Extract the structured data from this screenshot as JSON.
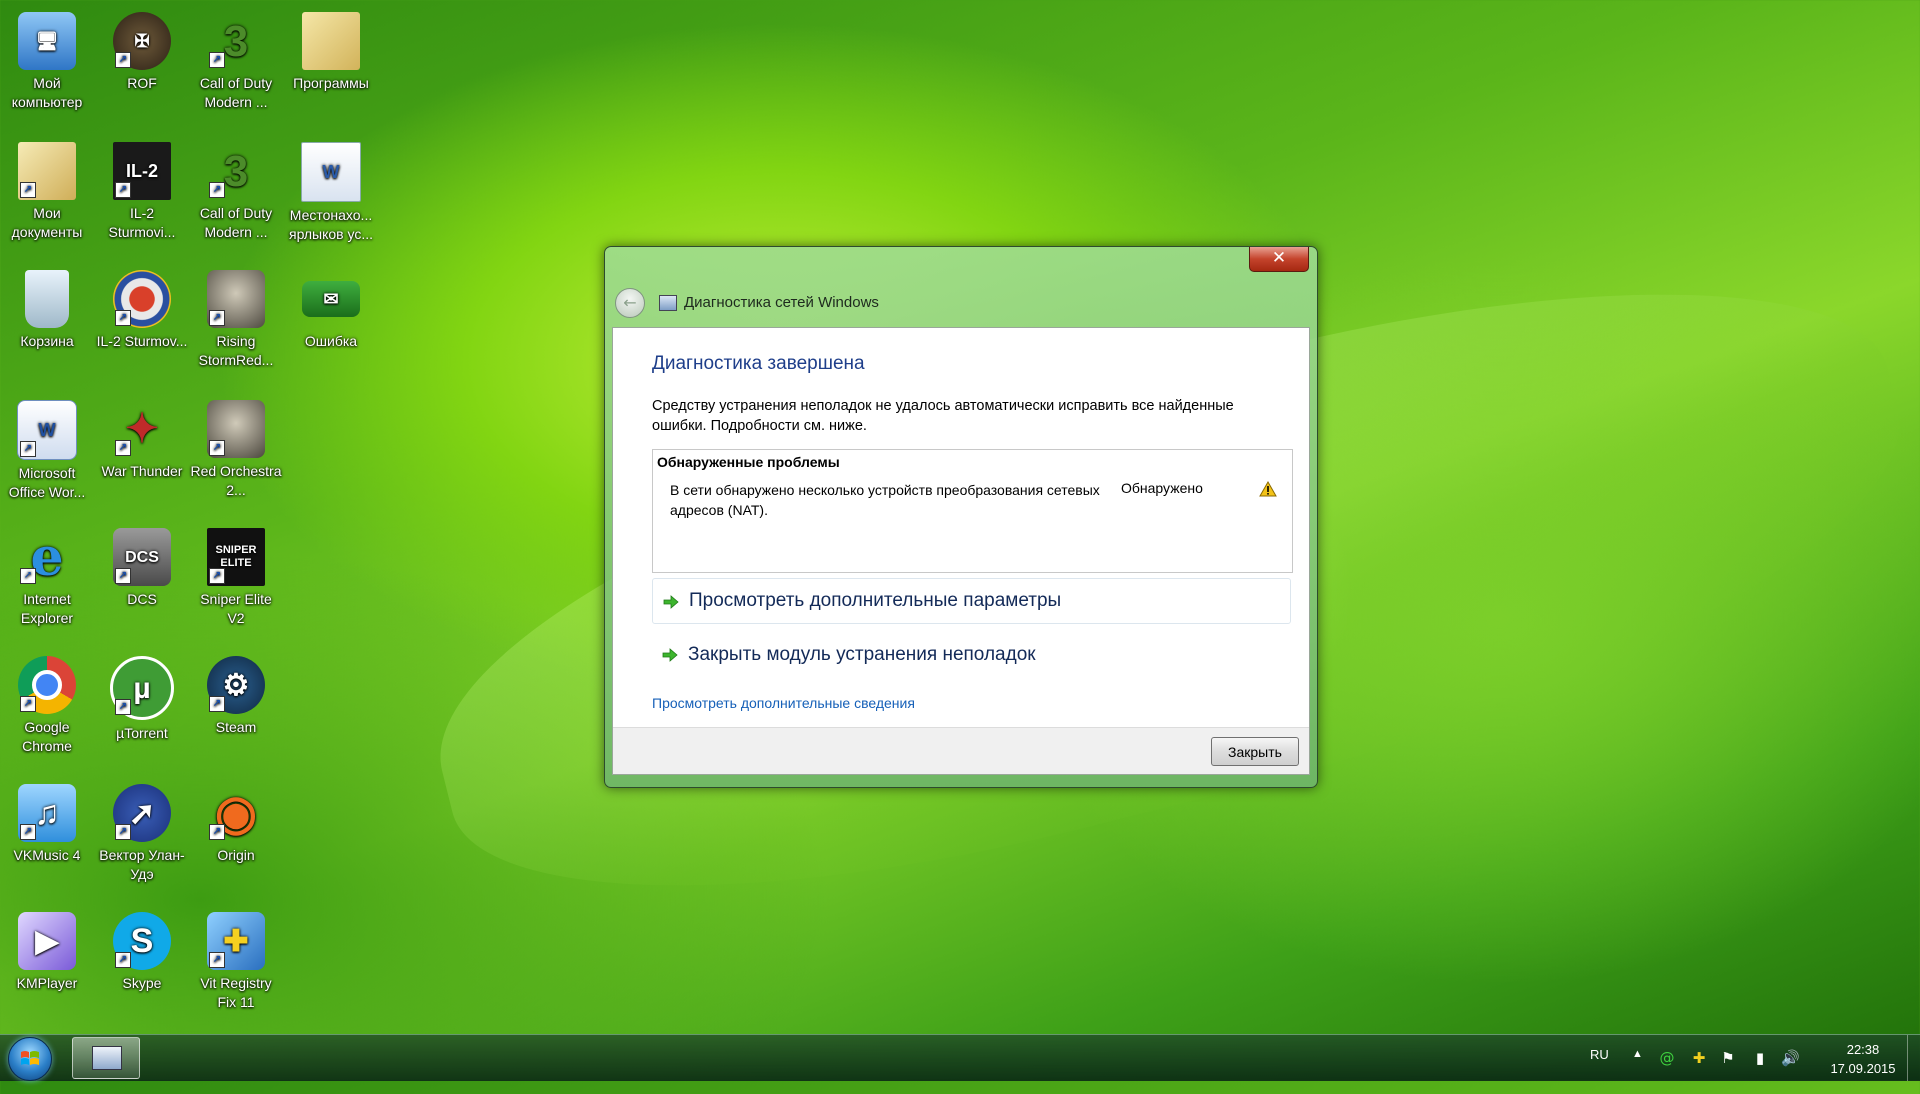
{
  "desktop": {
    "icons": [
      {
        "label": "Мой компьютер",
        "icon": "computer-icon"
      },
      {
        "label": "ROF",
        "icon": "rof-icon"
      },
      {
        "label": "Call of Duty Modern ...",
        "icon": "call-of-duty-icon"
      },
      {
        "label": "Программы",
        "icon": "folder-icon"
      },
      {
        "label": "Мои документы",
        "icon": "documents-folder-icon"
      },
      {
        "label": "IL-2 Sturmovi...",
        "icon": "il2-stalingrad-icon"
      },
      {
        "label": "Call of Duty Modern ...",
        "icon": "call-of-duty-icon"
      },
      {
        "label": "Местонахо... ярлыков ус...",
        "icon": "word-document-icon"
      },
      {
        "label": "Корзина",
        "icon": "recycle-bin-icon"
      },
      {
        "label": "IL-2 Sturmov...",
        "icon": "il2-target-icon"
      },
      {
        "label": "Rising StormRed...",
        "icon": "soldier-icon"
      },
      {
        "label": "Ошибка",
        "icon": "error-icon"
      },
      {
        "label": "Microsoft Office Wor...",
        "icon": "ms-word-icon"
      },
      {
        "label": "War Thunder",
        "icon": "war-thunder-icon"
      },
      {
        "label": "Red Orchestra 2...",
        "icon": "soldier-icon"
      },
      {
        "label": "Internet Explorer",
        "icon": "internet-explorer-icon"
      },
      {
        "label": "DCS",
        "icon": "dcs-icon"
      },
      {
        "label": "Sniper Elite V2",
        "icon": "sniper-elite-icon"
      },
      {
        "label": "Google Chrome",
        "icon": "chrome-icon"
      },
      {
        "label": "µTorrent",
        "icon": "utorrent-icon"
      },
      {
        "label": "Steam",
        "icon": "steam-icon"
      },
      {
        "label": "VKMusic 4",
        "icon": "vkmusic-icon"
      },
      {
        "label": "Вектор Улан-Удэ",
        "icon": "vector-icon"
      },
      {
        "label": "Origin",
        "icon": "origin-icon"
      },
      {
        "label": "KMPlayer",
        "icon": "kmplayer-icon"
      },
      {
        "label": "Skype",
        "icon": "skype-icon"
      },
      {
        "label": "Vit Registry Fix 11",
        "icon": "registry-fix-icon"
      }
    ],
    "icon_glyphs": {
      "rof": "✠",
      "il2": "IL-2",
      "dcs": "DCS",
      "sniper": "SNIPER ELITE",
      "steam": "⚙",
      "skype": "S",
      "utorrent": "µ",
      "origin": "◉",
      "vector": "➚",
      "music": "♫",
      "war": "✦",
      "ie": "e",
      "word": "W",
      "error": "✉",
      "kmp": "▶",
      "rsfix": "✚"
    }
  },
  "dialog": {
    "close_glyph": "✕",
    "back_glyph": "←",
    "title": "Диагностика сетей Windows",
    "heading": "Диагностика завершена",
    "description": "Средству устранения неполадок не удалось автоматически исправить все найденные ошибки. Подробности см. ниже.",
    "problems_header": "Обнаруженные проблемы",
    "problem_text": "В сети обнаружено несколько устройств преобразования сетевых адресов (NAT).",
    "problem_status": "Обнаружено",
    "command_view_options": "Просмотреть дополнительные параметры",
    "command_close_module": "Закрыть модуль устранения неполадок",
    "link_more_info": "Просмотреть дополнительные сведения",
    "close_button": "Закрыть"
  },
  "taskbar": {
    "language": "RU",
    "tray_up_glyph": "▲",
    "tray_icons": [
      "@",
      "✚",
      "⚑",
      "▮",
      "🔊"
    ],
    "time": "22:38",
    "date": "17.09.2015"
  }
}
